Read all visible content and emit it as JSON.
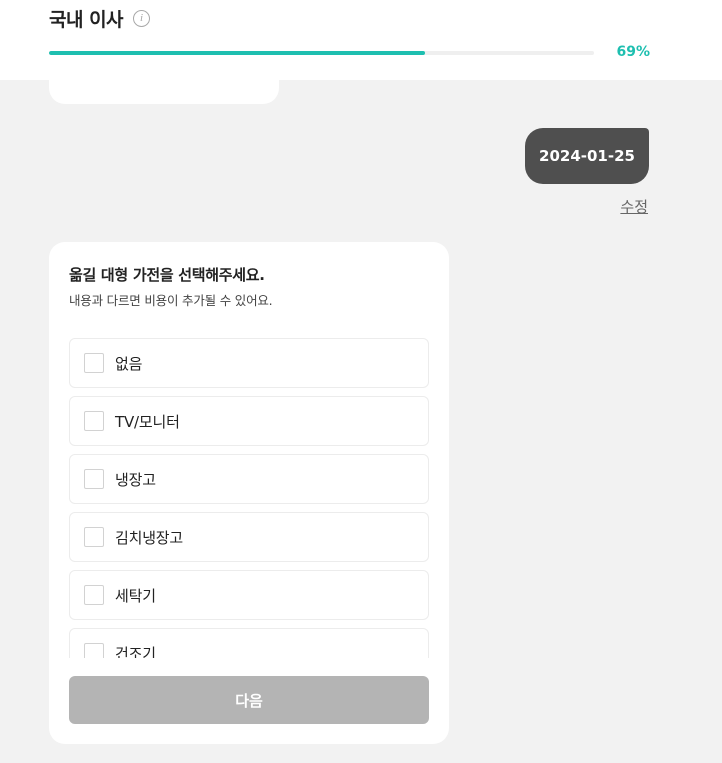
{
  "header": {
    "title": "국내 이사",
    "info_icon": "info-icon",
    "progress_value": 69,
    "progress_label": "69%",
    "accent_color": "#1ebfb0"
  },
  "chat": {
    "answer_date": "2024-01-25",
    "edit_label": "수정"
  },
  "question": {
    "title": "옮길 대형 가전을 선택해주세요.",
    "subtitle": "내용과 다르면 비용이 추가될 수 있어요.",
    "options": [
      {
        "label": "없음",
        "checked": false
      },
      {
        "label": "TV/모니터",
        "checked": false
      },
      {
        "label": "냉장고",
        "checked": false
      },
      {
        "label": "김치냉장고",
        "checked": false
      },
      {
        "label": "세탁기",
        "checked": false
      },
      {
        "label": "건조기",
        "checked": false
      }
    ],
    "next_label": "다음"
  }
}
